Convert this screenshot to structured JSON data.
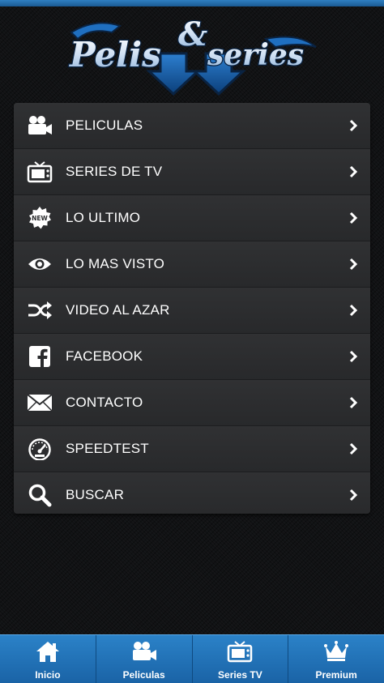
{
  "app": {
    "logo_text": "Pelis & Series"
  },
  "menu": {
    "items": [
      {
        "label": "PELICULAS",
        "icon": "movie-camera-icon"
      },
      {
        "label": "SERIES DE TV",
        "icon": "tv-icon"
      },
      {
        "label": "LO ULTIMO",
        "icon": "new-badge-icon",
        "badge": "NEW"
      },
      {
        "label": "LO MAS VISTO",
        "icon": "eye-icon"
      },
      {
        "label": "VIDEO AL AZAR",
        "icon": "shuffle-icon"
      },
      {
        "label": "FACEBOOK",
        "icon": "facebook-icon"
      },
      {
        "label": "CONTACTO",
        "icon": "envelope-icon"
      },
      {
        "label": "SPEEDTEST",
        "icon": "speedometer-icon"
      },
      {
        "label": "BUSCAR",
        "icon": "search-icon"
      }
    ]
  },
  "tabbar": {
    "tabs": [
      {
        "label": "Inicio",
        "icon": "home-icon"
      },
      {
        "label": "Peliculas",
        "icon": "movie-camera-icon"
      },
      {
        "label": "Series TV",
        "icon": "tv-icon"
      },
      {
        "label": "Premium",
        "icon": "crown-icon"
      }
    ]
  },
  "colors": {
    "accent": "#2b82c8",
    "menu_bg": "#2a2b2d",
    "page_bg": "#111214",
    "text": "#ffffff"
  }
}
